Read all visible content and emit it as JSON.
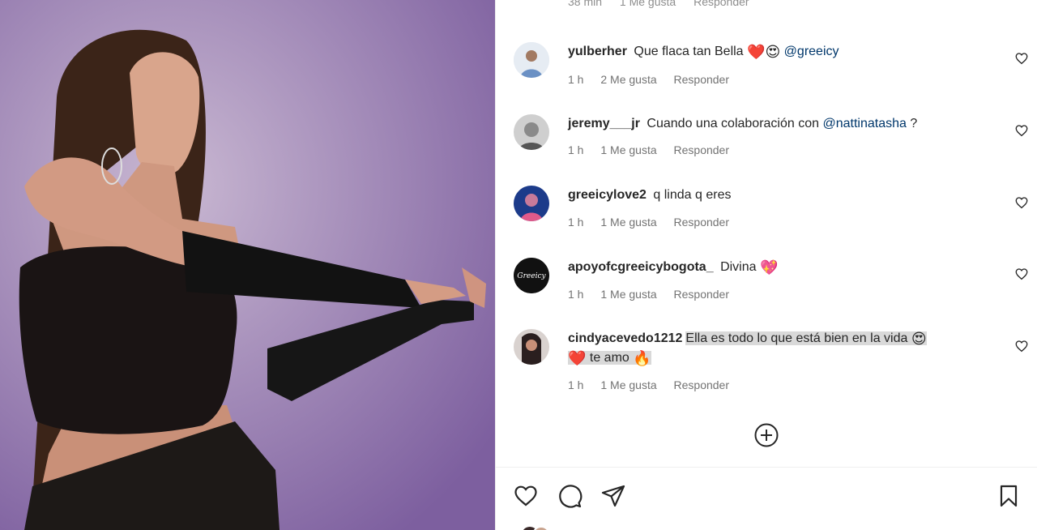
{
  "top_partial": {
    "time": "38 min",
    "likes": "1 Me gusta",
    "reply": "Responder"
  },
  "comments": [
    {
      "username": "yulberher",
      "text": "Que flaca tan Bella",
      "emojis": [
        "❤️",
        "😍"
      ],
      "mention": "@greeicy",
      "time": "1 h",
      "likes": "2 Me gusta",
      "reply": "Responder",
      "avatar_color": "#6a90c4"
    },
    {
      "username": "jeremy___jr",
      "text": "Cuando una colaboración con",
      "mention": "@nattinatasha",
      "suffix": "?",
      "time": "1 h",
      "likes": "1 Me gusta",
      "reply": "Responder",
      "avatar_color": "#7a7a7a"
    },
    {
      "username": "greeicylove2",
      "text": "q linda q eres",
      "time": "1 h",
      "likes": "1 Me gusta",
      "reply": "Responder",
      "avatar_color": "#1c3b8a"
    },
    {
      "username": "apoyofcgreeicybogota_",
      "text": "Divina",
      "emojis": [
        "💖"
      ],
      "time": "1 h",
      "likes": "1 Me gusta",
      "reply": "Responder",
      "avatar_color": "#111111",
      "avatar_text": "Greeicy"
    },
    {
      "username": "cindyacevedo1212",
      "text": "Ella es todo lo que está bien en la vida",
      "emojis": [
        "😍"
      ],
      "text2": "te amo",
      "emojis2_before": [
        "❤️"
      ],
      "emojis2_after": [
        "🔥"
      ],
      "time": "1 h",
      "likes": "1 Me gusta",
      "reply": "Responder",
      "avatar_color": "#3a2c2c"
    }
  ],
  "icons": {
    "comment_like": "heart-outline-icon",
    "load_more": "plus-circle-icon",
    "like": "heart-icon",
    "comment": "comment-icon",
    "share": "paper-plane-icon",
    "save": "bookmark-icon"
  },
  "colors": {
    "mention": "#00376b",
    "meta": "#737373",
    "highlight": "#d9d9d9"
  }
}
